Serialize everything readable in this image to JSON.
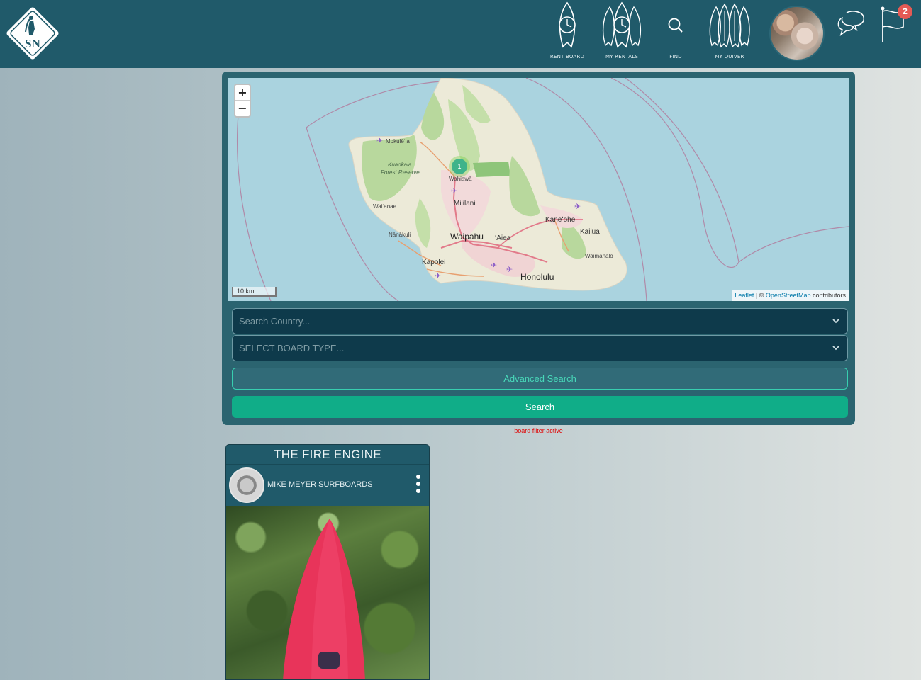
{
  "header": {
    "logo_text": "SN",
    "nav": [
      {
        "label": "RENT BOARD",
        "icon": "surfboard-clock-icon"
      },
      {
        "label": "MY RENTALS",
        "icon": "multi-surfboard-clock-icon"
      },
      {
        "label": "FIND",
        "icon": "search-icon"
      },
      {
        "label": "MY QUIVER",
        "icon": "surfboard-quiver-icon"
      }
    ],
    "notification_count": "2"
  },
  "map": {
    "zoom_in": "+",
    "zoom_out": "−",
    "cluster_count": "1",
    "scale_label": "10 km",
    "attribution": {
      "leaflet": "Leaflet",
      "sep": " | © ",
      "osm": "OpenStreetMap",
      "suffix": " contributors"
    },
    "places": {
      "mokuleia": "Mokulēʻia",
      "kuaokala": "Kuaokala",
      "forest_reserve": "Forest Reserve",
      "wahiawa": "Wahiawā",
      "waianae": "Waiʻanae",
      "mililani": "Mililani",
      "kaneohe": "Kāneʻohe",
      "kailua": "Kailua",
      "nanakuli": "Nānākuli",
      "waipahu": "Waipahu",
      "aiea": "ʻAiea",
      "waimanalo": "Waimānalo",
      "kapolei": "Kapolei",
      "honolulu": "Honolulu"
    }
  },
  "search": {
    "country_placeholder": "Search Country...",
    "board_type_placeholder": "SELECT BOARD TYPE...",
    "advanced_label": "Advanced Search",
    "search_label": "Search",
    "filter_note": "board filter active"
  },
  "card": {
    "title": "THE FIRE ENGINE",
    "maker": "MIKE MEYER SURFBOARDS"
  },
  "colors": {
    "header_bg": "#205a6a",
    "accent_green": "#10ad88",
    "filter_text": "#e00000"
  }
}
